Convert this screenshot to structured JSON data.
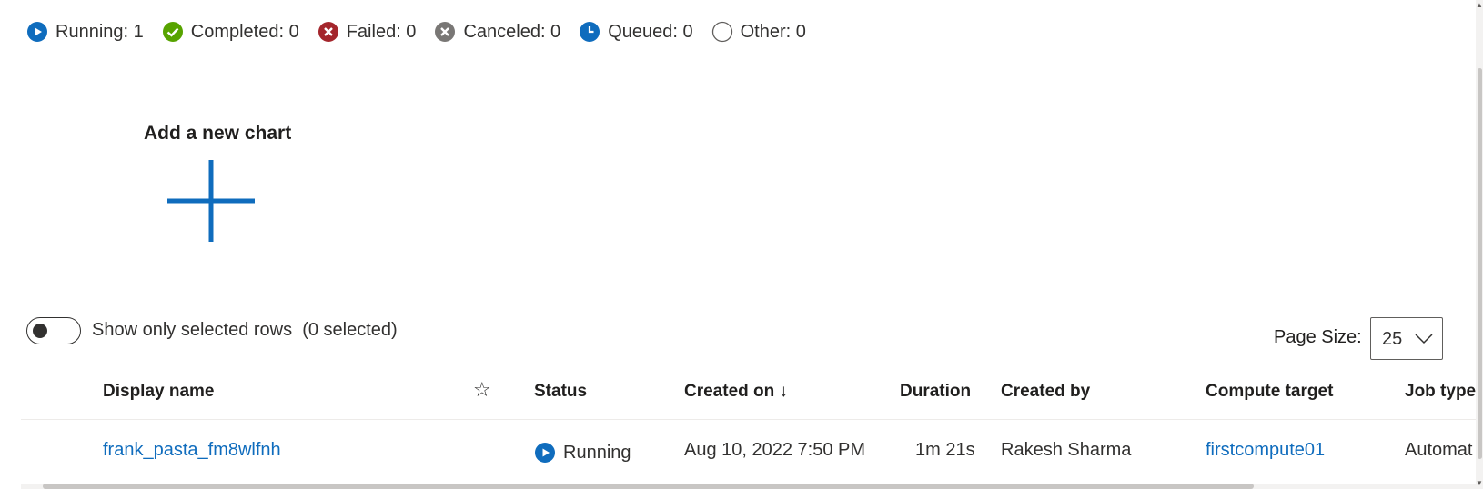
{
  "status_summary": [
    {
      "label": "Running: 1",
      "icon": "running-icon",
      "color": "#0f6cbd"
    },
    {
      "label": "Completed: 0",
      "icon": "completed-icon",
      "color": "#57a300"
    },
    {
      "label": "Failed: 0",
      "icon": "failed-icon",
      "color": "#a4262c"
    },
    {
      "label": "Canceled: 0",
      "icon": "canceled-icon",
      "color": "#797775"
    },
    {
      "label": "Queued: 0",
      "icon": "queued-icon",
      "color": "#0f6cbd"
    },
    {
      "label": "Other: 0",
      "icon": "other-icon",
      "color": "#605e5c"
    }
  ],
  "add_chart": {
    "title": "Add a new chart",
    "icon": "plus-icon",
    "color": "#0f6cbd"
  },
  "toggle": {
    "label": "Show only selected rows  (0 selected)",
    "on": false
  },
  "page_size": {
    "label": "Page Size:",
    "value": "25"
  },
  "table": {
    "columns": {
      "display_name": "Display name",
      "favorite": "☆",
      "status": "Status",
      "created_on": "Created on ↓",
      "duration": "Duration",
      "created_by": "Created by",
      "compute_target": "Compute target",
      "job_type": "Job type"
    },
    "rows": [
      {
        "display_name": "frank_pasta_fm8wlfnh",
        "status": "Running",
        "created_on": "Aug 10, 2022 7:50 PM",
        "duration": "1m 21s",
        "created_by": "Rakesh Sharma",
        "compute_target": "firstcompute01",
        "job_type": "Automat"
      }
    ]
  }
}
